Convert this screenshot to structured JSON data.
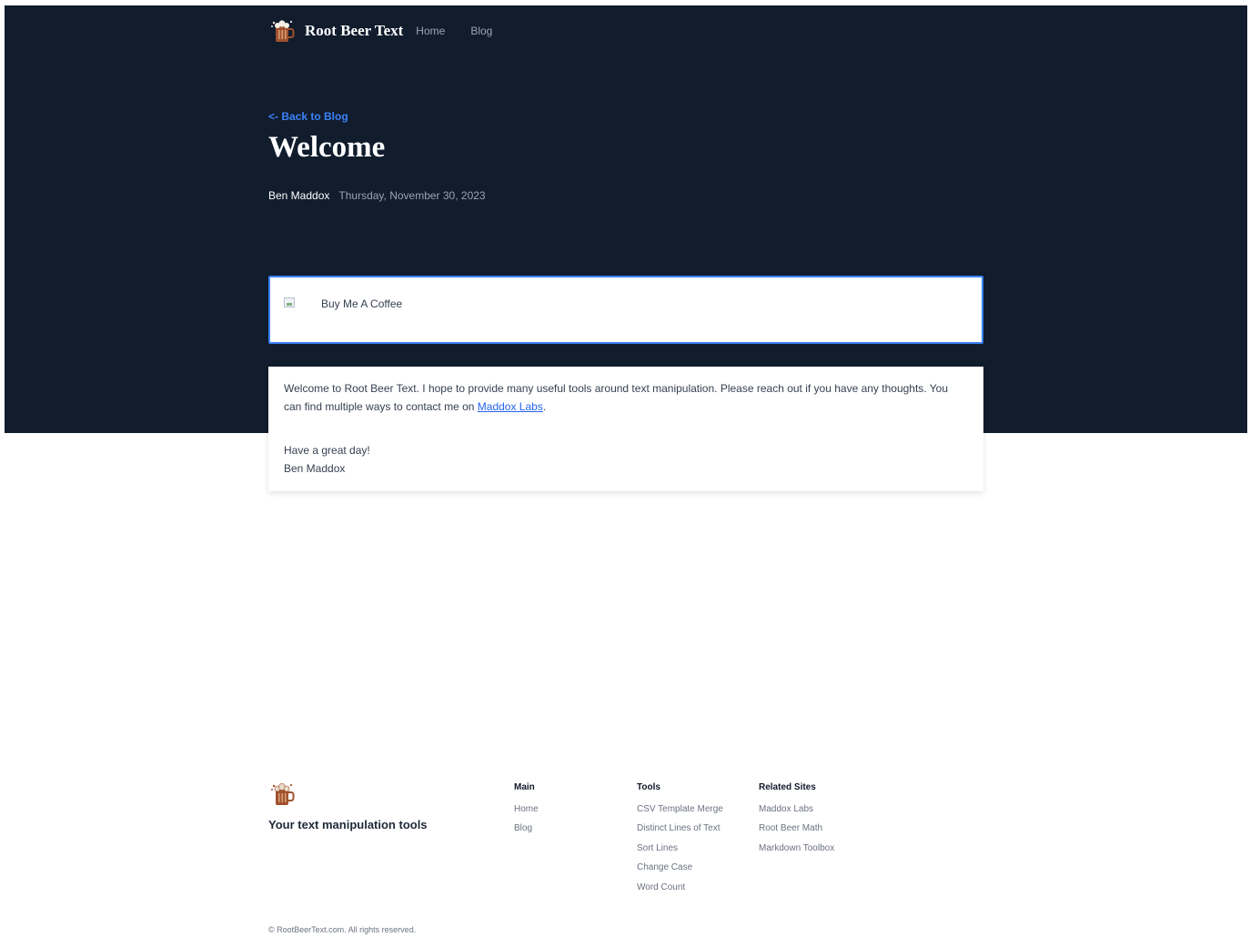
{
  "nav": {
    "brand": "Root Beer Text",
    "links": [
      "Home",
      "Blog"
    ]
  },
  "post": {
    "back_link": "<- Back to Blog",
    "title": "Welcome",
    "author": "Ben Maddox",
    "date": "Thursday, November 30, 2023"
  },
  "coffee": {
    "alt_text": "Buy Me A Coffee"
  },
  "article": {
    "intro": "Welcome to Root Beer Text. I hope to provide many useful tools around text manipulation. Please reach out if you have any thoughts. You can find multiple ways to contact me on ",
    "link_text": "Maddox Labs",
    "intro_end": ".",
    "closing": "Have a great day!",
    "signature": "Ben Maddox"
  },
  "footer": {
    "tagline": "Your text manipulation tools",
    "columns": [
      {
        "title": "Main",
        "links": [
          "Home",
          "Blog"
        ]
      },
      {
        "title": "Tools",
        "links": [
          "CSV Template Merge",
          "Distinct Lines of Text",
          "Sort Lines",
          "Change Case",
          "Word Count"
        ]
      },
      {
        "title": "Related Sites",
        "links": [
          "Maddox Labs",
          "Root Beer Math",
          "Markdown Toolbox"
        ]
      }
    ],
    "copyright": "© RootBeerText.com. All rights reserved."
  },
  "icons": {
    "logo": "root-beer-mug-icon",
    "broken_image": "broken-image-icon"
  },
  "colors": {
    "hero_bg": "#111c2d",
    "accent": "#3b82f6",
    "mug": "#a0522d",
    "foam": "#f5f0e6"
  }
}
